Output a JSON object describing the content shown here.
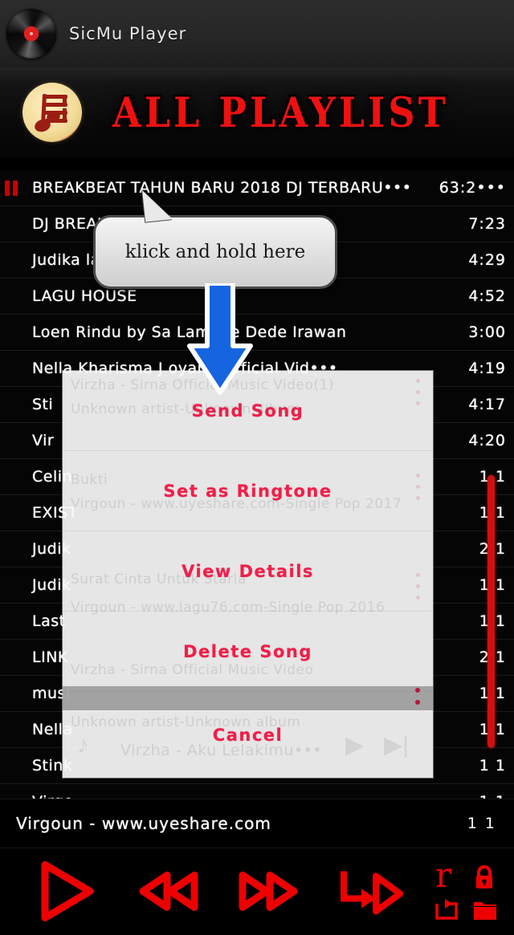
{
  "app": {
    "title": "SicMu Player",
    "icon": "vinyl-record-icon"
  },
  "banner": {
    "title": "ALL PLAYLIST",
    "icon": "music-note-playlist-icon"
  },
  "tooltip": {
    "text": "klick and hold here",
    "arrow": "blue-down-arrow"
  },
  "playlist": {
    "rows": [
      {
        "title": "BREAKBEAT TAHUN BARU 2018 DJ TERBARU•••",
        "duration": "63:2•••",
        "playing": true
      },
      {
        "title": "DJ BREAKBEAT POPULE•••",
        "duration": "7:23",
        "playing": false
      },
      {
        "title": "Judika lagu.com",
        "duration": "4:29",
        "playing": false
      },
      {
        "title": "LAGU HOUSE",
        "duration": "4:52",
        "playing": false
      },
      {
        "title": "Loen Rindu by Sa    Lamnoe  Dede Irawan",
        "duration": "3:00",
        "playing": false
      },
      {
        "title": "Nella Kharisma J      oyang  Official Vid•••",
        "duration": "4:19",
        "playing": false
      },
      {
        "title": "Sti",
        "duration": "4:17",
        "playing": false
      },
      {
        "title": "Vir",
        "duration": "4:20",
        "playing": false
      },
      {
        "title": "Celin",
        "duration": "1 1",
        "playing": false
      },
      {
        "title": "EXIST",
        "duration": "1 1",
        "playing": false
      },
      {
        "title": "Judik",
        "duration": "2 1",
        "playing": false
      },
      {
        "title": "Judik",
        "duration": "1 1",
        "playing": false
      },
      {
        "title": "Last",
        "duration": "1 1",
        "playing": false
      },
      {
        "title": "LINK",
        "duration": "2 1",
        "playing": false
      },
      {
        "title": "musi",
        "duration": "1 1",
        "playing": false
      },
      {
        "title": "Nella",
        "duration": "1 1",
        "playing": false
      },
      {
        "title": "Stink",
        "duration": "1 1",
        "playing": false
      },
      {
        "title": "Virgo",
        "duration": "1 1",
        "playing": false
      }
    ],
    "last_row": {
      "title": "Virgoun - www.uyeshare.com",
      "duration": "1 1"
    }
  },
  "dialog": {
    "items": [
      {
        "label": "Send Song",
        "name": "send-song"
      },
      {
        "label": "Set as Ringtone",
        "name": "set-as-ringtone"
      },
      {
        "label": "View Details",
        "name": "view-details"
      },
      {
        "label": "Delete Song",
        "name": "delete-song"
      },
      {
        "label": "Cancel",
        "name": "cancel"
      }
    ],
    "background_rows": [
      "Virzha - Sirna Official Music Video(1)",
      "Unknown artist-Unknown album",
      "Bukti",
      "Virgoun - www.uyeshare.com-Single Pop 2017",
      "Surat Cinta Untuk Starla",
      "Virgoun - www.lagu76.com-Single Pop 2016",
      "Virzha - Sirna Official Music Video",
      "Unknown artist-Unknown album",
      "Virzha - Aku Lelakimu•••"
    ]
  },
  "toolbar": {
    "play": "play-button",
    "previous": "rewind-button",
    "next": "fast-forward-button",
    "shuffle": "next-track-button",
    "repeat_letter": "r",
    "lock": "lock-icon",
    "loop": "repeat-icon",
    "folder": "folder-icon"
  },
  "colors": {
    "accent_red": "#ee0000",
    "menu_red": "#ef1f49",
    "arrow_blue": "#1565e0",
    "background": "#000000"
  }
}
